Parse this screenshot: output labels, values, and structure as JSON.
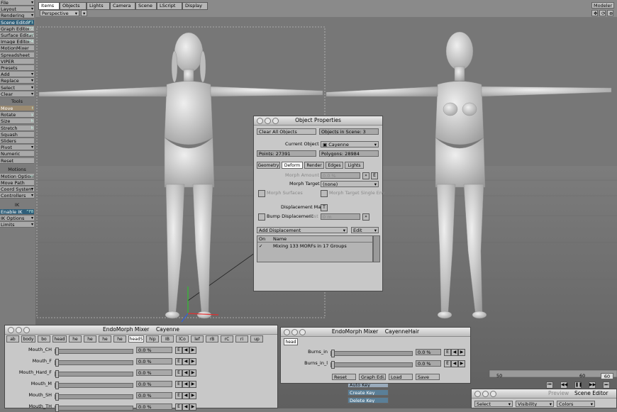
{
  "sidebar": {
    "items": [
      {
        "label": "File",
        "style": "normal",
        "arrow": "▾"
      },
      {
        "label": "Layout",
        "style": "normal",
        "arrow": "▾"
      },
      {
        "label": "Rendering",
        "style": "normal",
        "arrow": "▾"
      },
      {
        "label": "Scene Editor",
        "style": "active",
        "key": "^F1"
      },
      {
        "label": "Graph Editor",
        "style": "normal",
        "key": "^F2"
      },
      {
        "label": "Surface Editor",
        "style": "normal",
        "key": "^F3"
      },
      {
        "label": "Image Editor",
        "style": "normal",
        "key": "^F4"
      },
      {
        "label": "MotionMixer",
        "style": "normal"
      },
      {
        "label": "Spreadsheet",
        "style": "normal"
      },
      {
        "label": "VIPER",
        "style": "normal"
      },
      {
        "label": "Presets",
        "style": "normal"
      },
      {
        "label": "Add",
        "style": "normal",
        "arrow": "▾"
      },
      {
        "label": "Replace",
        "style": "normal",
        "arrow": "▾"
      },
      {
        "label": "Select",
        "style": "normal",
        "arrow": "▾"
      },
      {
        "label": "Clear",
        "style": "normal",
        "arrow": "▾"
      }
    ],
    "tools_header": "Tools",
    "tools": [
      {
        "label": "Move",
        "style": "orange",
        "key": "t"
      },
      {
        "label": "Rotate",
        "style": "normal",
        "key": "y"
      },
      {
        "label": "Size",
        "style": "normal",
        "key": "h"
      },
      {
        "label": "Stretch",
        "style": "normal",
        "key": "h"
      },
      {
        "label": "Squash",
        "style": "normal"
      },
      {
        "label": "Sliders",
        "style": "normal"
      },
      {
        "label": "Pivot",
        "style": "normal",
        "arrow": "▾"
      },
      {
        "label": "Numeric",
        "style": "normal"
      },
      {
        "label": "Reset",
        "style": "normal"
      }
    ],
    "motions_header": "Motions",
    "motions": [
      {
        "label": "Motion Options",
        "style": "normal",
        "key": "m"
      },
      {
        "label": "Move Path",
        "style": "normal"
      },
      {
        "label": "Coord System",
        "style": "normal",
        "arrow": "▾"
      },
      {
        "label": "Controllers",
        "style": "normal",
        "arrow": "▾"
      }
    ],
    "ik_header": "IK",
    "ik": [
      {
        "label": "Enable IK",
        "style": "active",
        "key": "^F8"
      },
      {
        "label": "IK Options",
        "style": "normal",
        "arrow": "▾"
      },
      {
        "label": "Limits",
        "style": "normal",
        "arrow": "▾"
      }
    ]
  },
  "topbar": {
    "tabs": [
      "Items",
      "Objects",
      "Lights",
      "Camera",
      "Scene",
      "LScript",
      "Display"
    ],
    "active_tab": "Items",
    "view_mode": "Perspective",
    "modeler_label": "Modeler"
  },
  "object_properties": {
    "title": "Object Properties",
    "clear_all": "Clear All Objects",
    "objects_in_scene": "Objects in Scene: 3",
    "current_object_label": "Current Object",
    "current_object": "Cayenne",
    "points": "Points: 27391",
    "polygons": "Polygons: 28984",
    "tabs": [
      "Geometry",
      "Deform",
      "Render",
      "Edges",
      "Lights"
    ],
    "active_tab": "Deform",
    "morph_amount_label": "Morph Amount",
    "morph_amount_value": "0.0 %",
    "morph_target_label": "Morph Target",
    "morph_target_value": "(none)",
    "morph_surfaces": "Morph Surfaces",
    "morph_target_single_env": "Morph Target Single Env",
    "displacement_map_label": "Displacement Map",
    "displacement_map_btn": "T",
    "bump_displacement": "Bump Displacement",
    "dist_label": "Dist",
    "dist_value": "0 m",
    "add_displacement": "Add Displacement",
    "edit": "Edit",
    "col_on": "On",
    "col_name": "Name",
    "row_check": "✓",
    "row_name": "Mixing 133 MORFs in 17 Groups"
  },
  "mixer_left": {
    "title": "EndoMorph Mixer",
    "object": "Cayenne",
    "tabs": [
      "ab",
      "body",
      "bo",
      "head",
      "he",
      "he",
      "he",
      "he",
      "headS",
      "hip",
      "IB",
      "lCo",
      "lef",
      "rB",
      "rC",
      "ri",
      "up"
    ],
    "active_tab": "headS",
    "rows": [
      {
        "label": "Mouth_CH",
        "value": "0.0 %"
      },
      {
        "label": "Mouth_F",
        "value": "0.0 %"
      },
      {
        "label": "Mouth_Hard_F",
        "value": "0.0 %"
      },
      {
        "label": "Mouth_M",
        "value": "0.0 %"
      },
      {
        "label": "Mouth_SH",
        "value": "0.0 %"
      },
      {
        "label": "Mouth_TH",
        "value": "0.0 %"
      }
    ]
  },
  "mixer_right": {
    "title": "EndoMorph Mixer",
    "object": "CayenneHair",
    "tab": "head",
    "rows": [
      {
        "label": "Burns_in",
        "value": "0.0 %"
      },
      {
        "label": "Burns_in_l",
        "value": "0.0 %"
      }
    ],
    "buttons": [
      "Reset",
      "Graph Edi...",
      "Load",
      "Save"
    ]
  },
  "timeline": {
    "tick_labels": [
      "50",
      "60",
      "60"
    ]
  },
  "keys": {
    "auto_key": "Auto Key",
    "create_key": "Create Key",
    "delete_key": "Delete Key"
  },
  "scene_editor": {
    "preview": "Preview",
    "title": "Scene Editor",
    "select": "Select",
    "visibility": "Visibility",
    "colors": "Colors"
  },
  "colors": {
    "accent_blue": "#2f5f7a",
    "panel_gray": "#c8c8c8",
    "viewport_gray": "#777777",
    "axis_x": "#e03030",
    "axis_y": "#30c030",
    "axis_z": "#3060e0"
  }
}
